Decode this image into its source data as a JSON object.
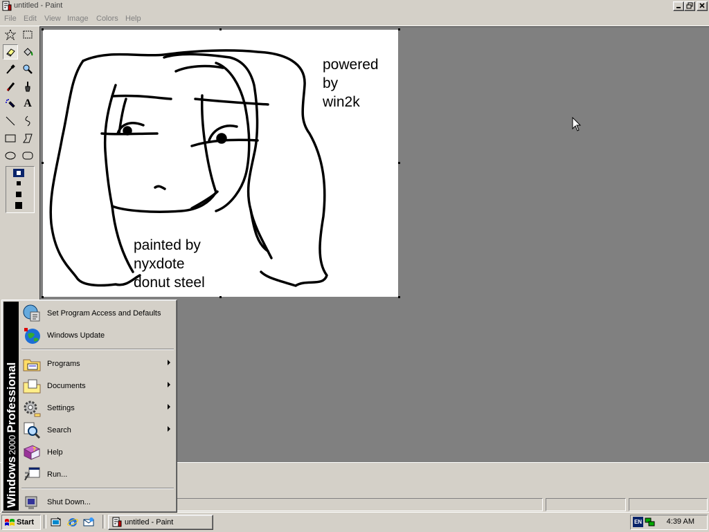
{
  "window": {
    "title": "untitled - Paint",
    "controls": [
      "minimize",
      "restore",
      "close"
    ]
  },
  "menubar": {
    "items": [
      "File",
      "Edit",
      "View",
      "Image",
      "Colors",
      "Help"
    ]
  },
  "toolbox": {
    "tools": [
      {
        "name": "free-form-select",
        "icon": "star-select-icon"
      },
      {
        "name": "select",
        "icon": "rect-select-icon"
      },
      {
        "name": "eraser",
        "icon": "eraser-icon",
        "active": true
      },
      {
        "name": "fill-with-color",
        "icon": "paint-bucket-icon"
      },
      {
        "name": "pick-color",
        "icon": "eyedropper-icon"
      },
      {
        "name": "magnifier",
        "icon": "magnifier-icon"
      },
      {
        "name": "pencil",
        "icon": "pencil-icon"
      },
      {
        "name": "brush",
        "icon": "brush-icon"
      },
      {
        "name": "airbrush",
        "icon": "airbrush-icon"
      },
      {
        "name": "text",
        "icon": "text-icon",
        "glyph": "A"
      },
      {
        "name": "line",
        "icon": "line-icon"
      },
      {
        "name": "curve",
        "icon": "curve-icon"
      },
      {
        "name": "rectangle",
        "icon": "rectangle-icon"
      },
      {
        "name": "polygon",
        "icon": "polygon-icon"
      },
      {
        "name": "ellipse",
        "icon": "ellipse-icon"
      },
      {
        "name": "rounded-rectangle",
        "icon": "rounded-rect-icon"
      }
    ]
  },
  "canvas": {
    "text_powered": "powered\nby\nwin2k",
    "text_painted": "painted by\nnyxdote\ndonut steel"
  },
  "start_menu": {
    "banner": "Windows 2000 Professional",
    "banner_windows": "Windows",
    "banner_version": "2000",
    "banner_edition": "Professional",
    "items": [
      {
        "label": "Set Program Access and Defaults",
        "icon": "program-access-icon",
        "submenu": false
      },
      {
        "label": "Windows Update",
        "icon": "windows-update-globe-icon",
        "submenu": false
      },
      {
        "label": "Programs",
        "icon": "programs-folder-icon",
        "submenu": true
      },
      {
        "label": "Documents",
        "icon": "documents-folder-icon",
        "submenu": true
      },
      {
        "label": "Settings",
        "icon": "settings-gear-icon",
        "submenu": true
      },
      {
        "label": "Search",
        "icon": "search-magnifier-icon",
        "submenu": true
      },
      {
        "label": "Help",
        "icon": "help-book-icon",
        "submenu": false
      },
      {
        "label": "Run...",
        "icon": "run-icon",
        "submenu": false
      },
      {
        "label": "Shut Down...",
        "icon": "shutdown-icon",
        "submenu": false
      }
    ]
  },
  "taskbar": {
    "start_label": "Start",
    "quick_launch": [
      "show-desktop-icon",
      "internet-explorer-icon",
      "outlook-express-icon"
    ],
    "tasks": [
      {
        "label": "untitled - Paint",
        "icon": "paint-app-icon"
      }
    ],
    "tray": {
      "language": "EN",
      "clock": "4:39 AM"
    }
  },
  "colors": {
    "face": "#d4d0c8",
    "workspace": "#808080",
    "banner_blue": "#0a246a"
  }
}
